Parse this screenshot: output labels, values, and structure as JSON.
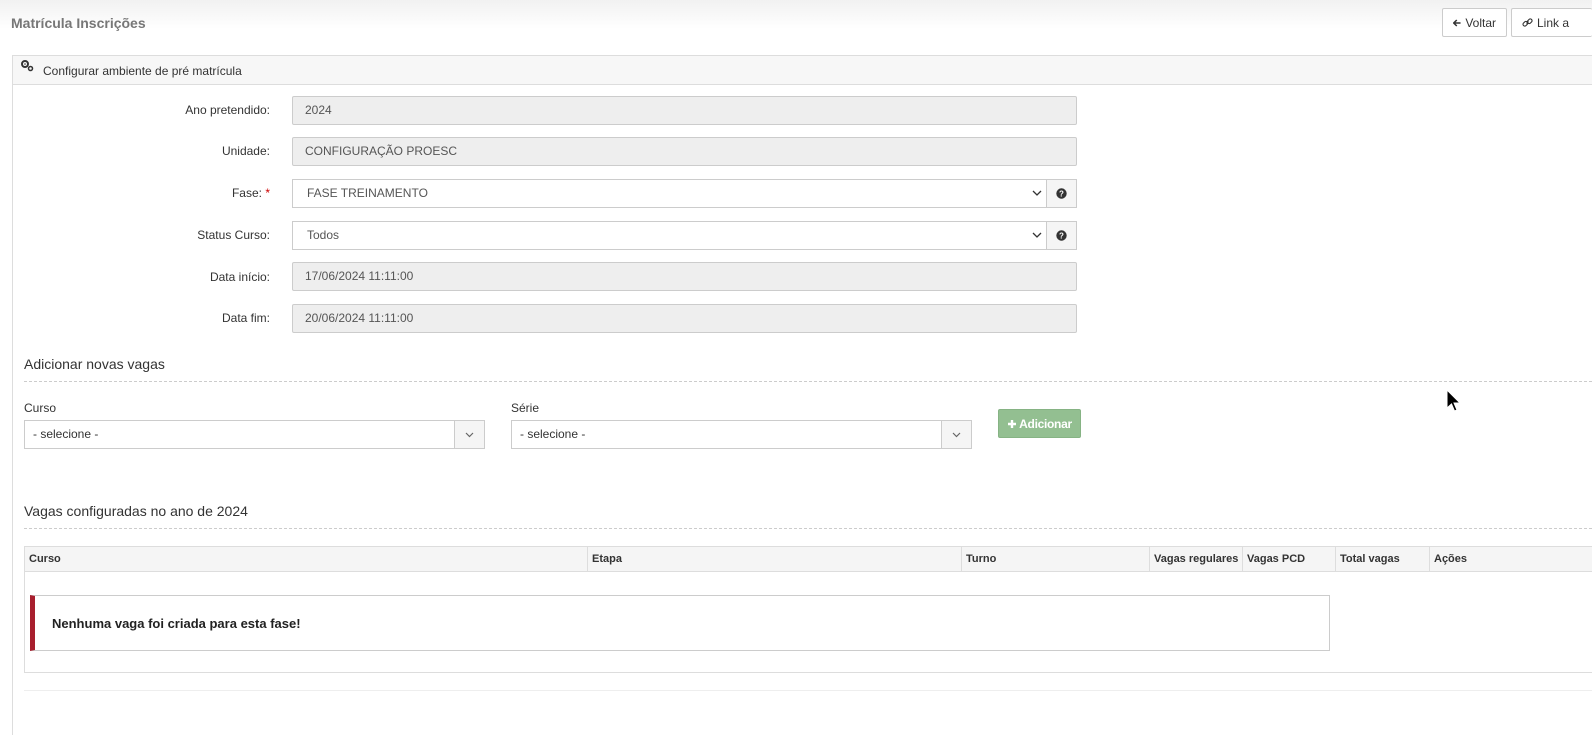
{
  "header": {
    "title": "Matrícula Inscrições",
    "back_label": "Voltar",
    "link_label": "Link a"
  },
  "panel": {
    "title": "Configurar ambiente de pré matrícula"
  },
  "form": {
    "ano_label": "Ano pretendido:",
    "ano_value": "2024",
    "unidade_label": "Unidade:",
    "unidade_value": "CONFIGURAÇÃO PROESC",
    "fase_label": "Fase:",
    "fase_required": "*",
    "fase_value": "FASE TREINAMENTO",
    "status_label": "Status Curso:",
    "status_value": "Todos",
    "inicio_label": "Data início:",
    "inicio_value": "17/06/2024 11:11:00",
    "fim_label": "Data fim:",
    "fim_value": "20/06/2024 11:11:00"
  },
  "add_section": {
    "title": "Adicionar novas vagas",
    "curso_label": "Curso",
    "curso_value": "- selecione -",
    "serie_label": "Série",
    "serie_value": "- selecione -",
    "add_button": "Adicionar"
  },
  "table_section": {
    "title": "Vagas configuradas no ano de 2024",
    "columns": [
      "Curso",
      "Etapa",
      "Turno",
      "Vagas regulares",
      "Vagas PCD",
      "Total vagas",
      "Ações"
    ],
    "empty_message": "Nenhuma vaga foi criada para esta fase!"
  },
  "colors": {
    "add_button_bg": "#93bf91",
    "alert_border": "#a81f2e",
    "required": "#cc0000"
  }
}
